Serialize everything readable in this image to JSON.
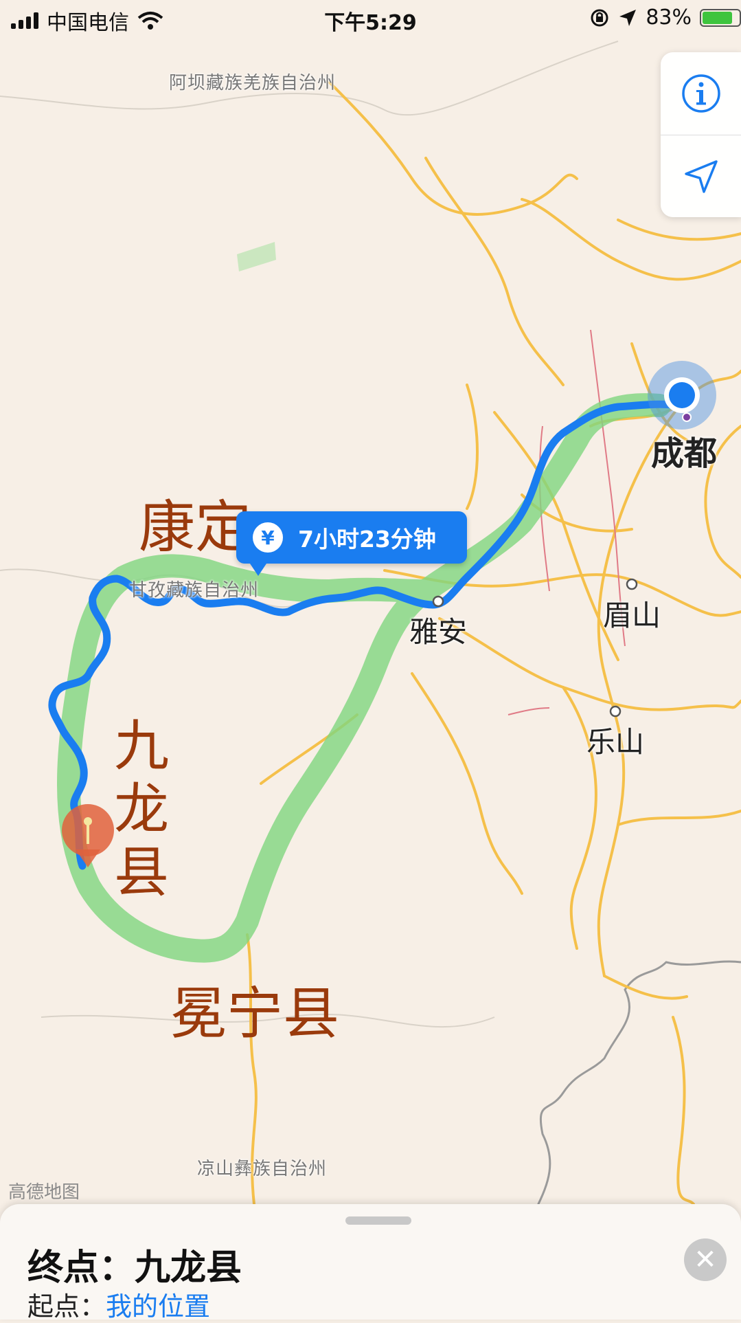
{
  "status_bar": {
    "carrier": "中国电信",
    "time": "下午5:29",
    "battery_percent": "83%",
    "battery_level": 0.83,
    "icons": [
      "signal-bars-icon",
      "wifi-icon",
      "orientation-lock-icon",
      "location-arrow-icon",
      "battery-icon"
    ]
  },
  "map": {
    "regions": {
      "aba": "阿坝藏族羌族自治州",
      "ganzi": "甘孜藏族自治州",
      "liangshan": "凉山彝族自治州"
    },
    "cities": {
      "chengdu": "成都",
      "yaan": "雅安",
      "meishan": "眉山",
      "leshan": "乐山"
    },
    "route_time": "7小时23分钟",
    "fare_icon": "yen-icon",
    "annotations": {
      "kangding": "康定",
      "jiulong": "九龙县",
      "mianning": "冕宁县"
    },
    "watermark": "高德地图",
    "route_color": "#1a7df0",
    "highlight_color": "#7fd67f",
    "road_color": "#f5c04a"
  },
  "controls": {
    "info_icon": "info-icon",
    "locate_icon": "location-arrow-icon"
  },
  "bottom_sheet": {
    "destination_label": "终点：",
    "destination_value": "九龙县",
    "origin_label": "起点：",
    "origin_value": "我的位置",
    "close_icon": "close-icon"
  }
}
